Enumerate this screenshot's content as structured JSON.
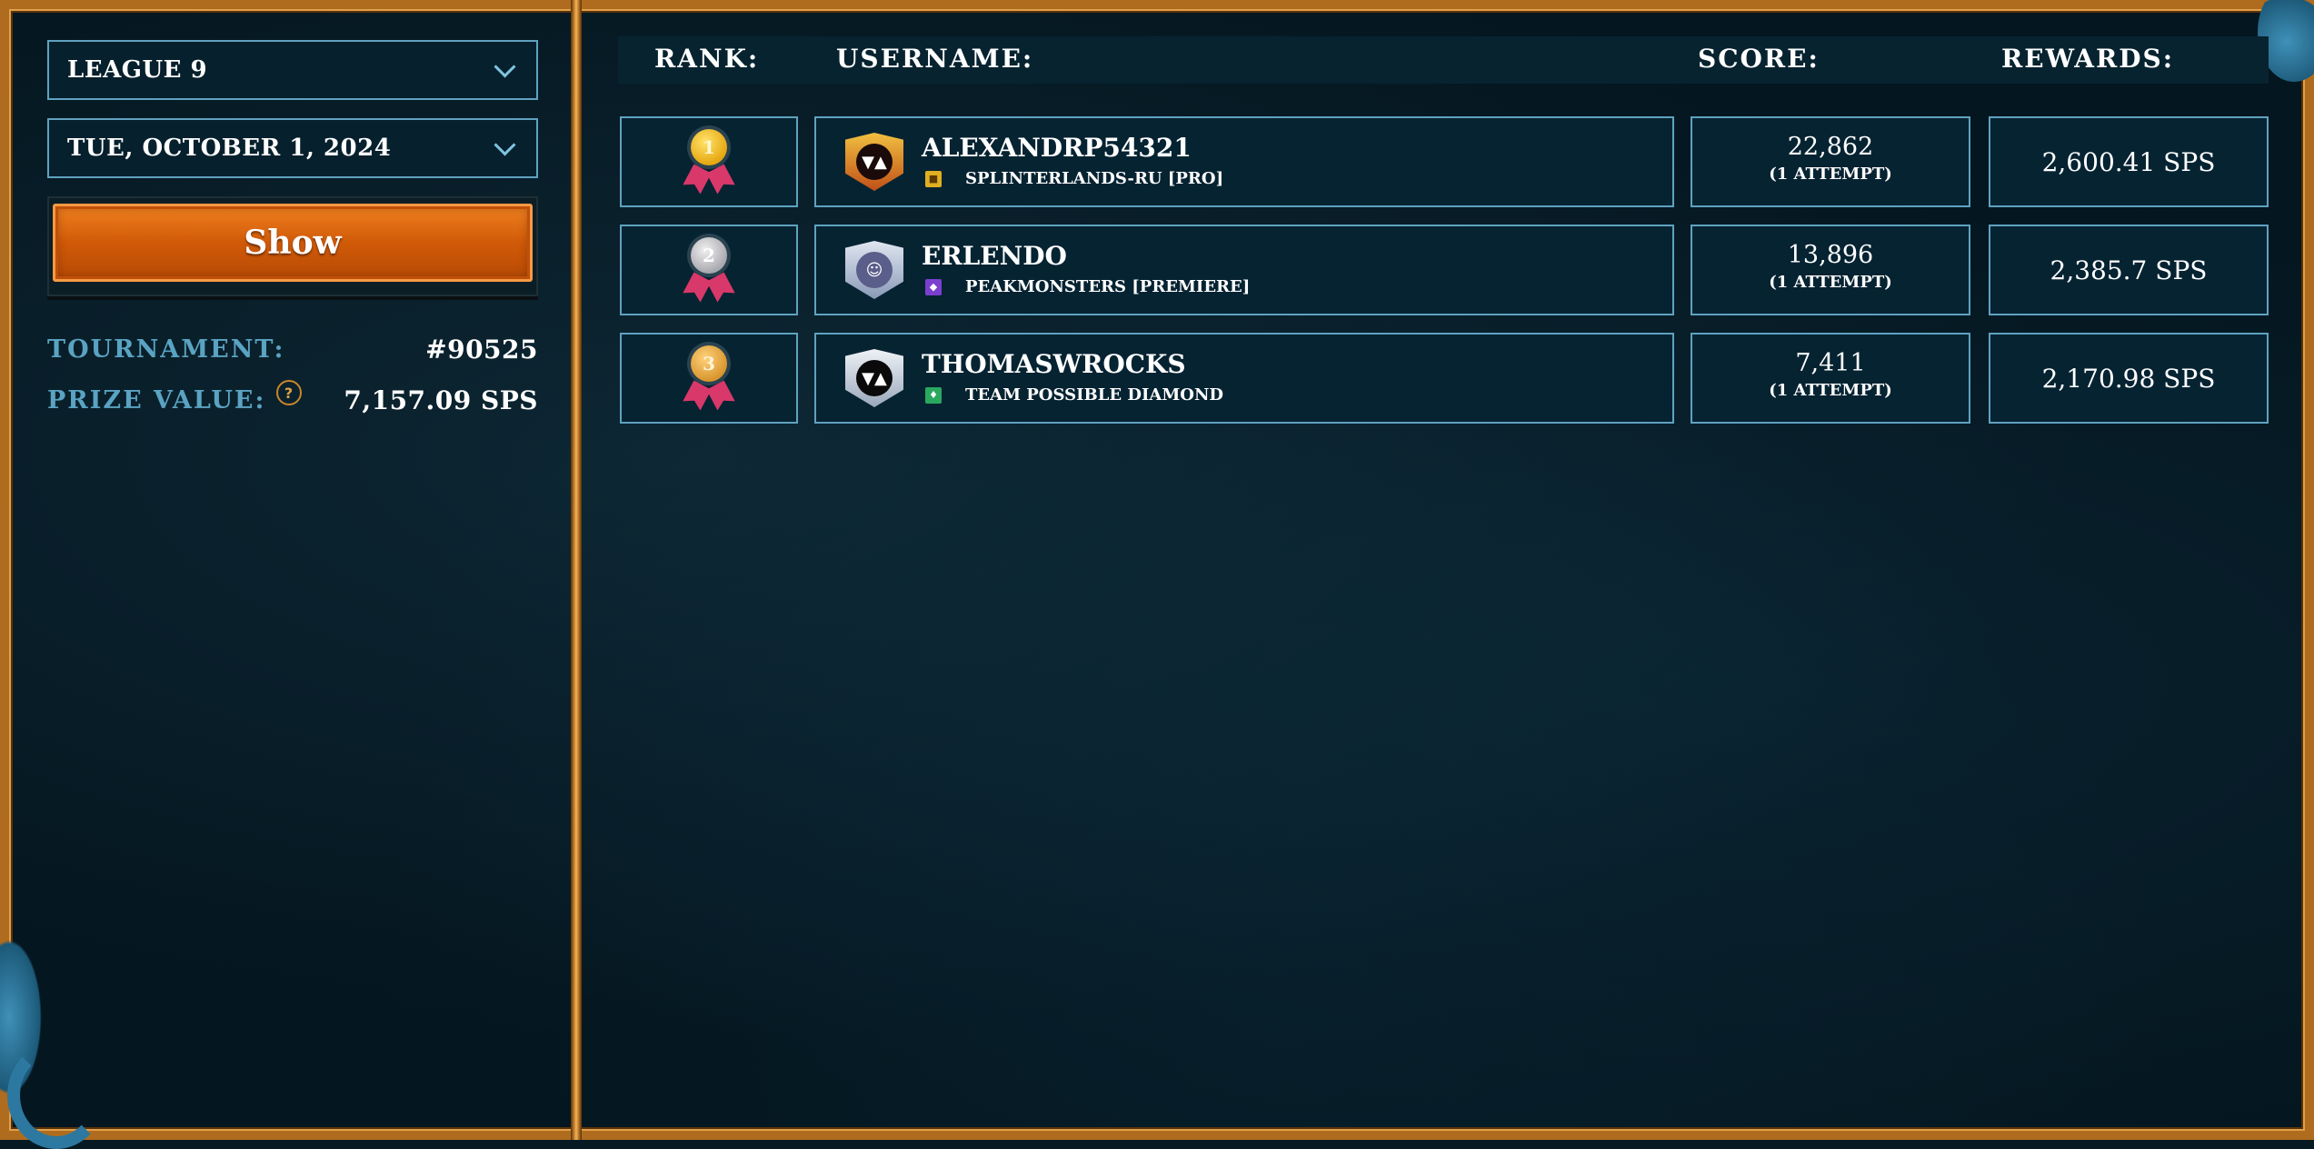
{
  "filters": {
    "league": "LEAGUE 9",
    "date": "TUE, OCTOBER 1, 2024",
    "show_label": "Show"
  },
  "info": {
    "tournament_label": "TOURNAMENT:",
    "tournament_value": "#90525",
    "prize_label": "PRIZE VALUE:",
    "prize_help": "?",
    "prize_value": "7,157.09 SPS"
  },
  "table": {
    "headers": {
      "rank": "RANK:",
      "username": "USERNAME:",
      "score": "SCORE:",
      "rewards": "REWARDS:"
    },
    "rows": [
      {
        "rank": "1",
        "medal": "gold",
        "username": "ALEXANDRP54321",
        "avatar_icon": "monster-avatar-icon",
        "guild": "SPLINTERLANDS-RU [PRO]",
        "guild_color": "#e0b020",
        "score": "22,862",
        "attempts": "(1 ATTEMPT)",
        "reward": "2,600.41 SPS"
      },
      {
        "rank": "2",
        "medal": "silver",
        "username": "ERLENDO",
        "avatar_icon": "character-avatar-icon",
        "guild": "PEAKMONSTERS [PREMIERE]",
        "guild_color": "#7b3fd0",
        "score": "13,896",
        "attempts": "(1 ATTEMPT)",
        "reward": "2,385.7 SPS"
      },
      {
        "rank": "3",
        "medal": "bronze",
        "username": "THOMASWROCKS",
        "avatar_icon": "monster-avatar-icon",
        "guild": "TEAM POSSIBLE DIAMOND",
        "guild_color": "#2aa860",
        "score": "7,411",
        "attempts": "(1 ATTEMPT)",
        "reward": "2,170.98 SPS"
      }
    ]
  }
}
